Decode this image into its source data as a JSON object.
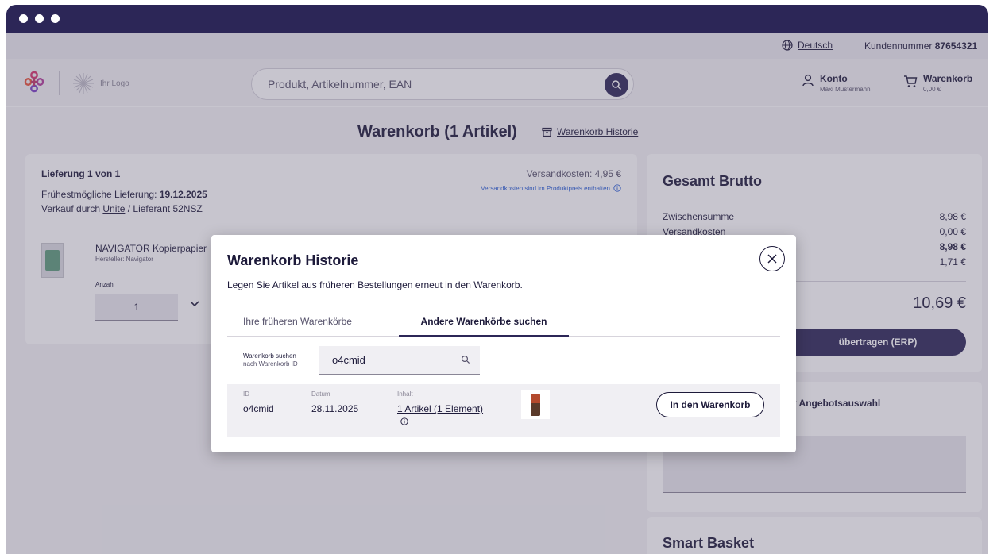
{
  "topbar": {
    "language": "Deutsch",
    "customer_label": "Kundennummer",
    "customer_number": "87654321"
  },
  "header": {
    "logo_text": "Ihr Logo",
    "search_placeholder": "Produkt, Artikelnummer, EAN",
    "account_label": "Konto",
    "account_user": "Maxi Mustermann",
    "cart_label": "Warenkorb",
    "cart_amount": "0,00 €"
  },
  "page": {
    "title": "Warenkorb (1 Artikel)",
    "history_link": "Warenkorb Historie"
  },
  "delivery": {
    "label": "Lieferung 1 von 1",
    "shipping": "Versandkosten: 4,95 €",
    "shipping_info": "Versandkosten sind im Produktpreis enthalten",
    "earliest_label": "Frühestmögliche Lieferung:",
    "earliest_date": "19.12.2025",
    "sold_prefix": "Verkauf durch",
    "sold_by": "Unite",
    "sold_suffix": "/ Lieferant 52NSZ"
  },
  "product": {
    "name": "NAVIGATOR Kopierpapier",
    "manufacturer": "Hersteller: Navigator",
    "qty_label": "Anzahl",
    "qty_value": "1"
  },
  "summary": {
    "title": "Gesamt Brutto",
    "rows": [
      {
        "label": "Zwischensumme",
        "value": "8,98 €"
      },
      {
        "label": "Versandkosten",
        "value": "0,00 €"
      },
      {
        "label": "",
        "value": "8,98 €"
      },
      {
        "label": "",
        "value": "1,71 €"
      }
    ],
    "total": "10,69 €",
    "erp_button": "übertragen (ERP)"
  },
  "offer": {
    "title": "r Angebotsauswahl"
  },
  "smart_basket": {
    "title": "Smart Basket"
  },
  "modal": {
    "title": "Warenkorb Historie",
    "subtitle": "Legen Sie Artikel aus früheren Bestellungen erneut in den Warenkorb.",
    "tabs": [
      "Ihre früheren Warenkörbe",
      "Andere Warenkörbe suchen"
    ],
    "search_label_1": "Warenkorb suchen",
    "search_label_2": "nach Warenkorb ID",
    "search_value": "o4cmid",
    "result": {
      "id_label": "ID",
      "id": "o4cmid",
      "date_label": "Datum",
      "date": "28.11.2025",
      "content_label": "Inhalt",
      "content": "1 Artikel (1 Element)",
      "button": "In den Warenkorb"
    }
  },
  "colors": {
    "primary": "#2c2657",
    "link": "#2a5fd6"
  }
}
